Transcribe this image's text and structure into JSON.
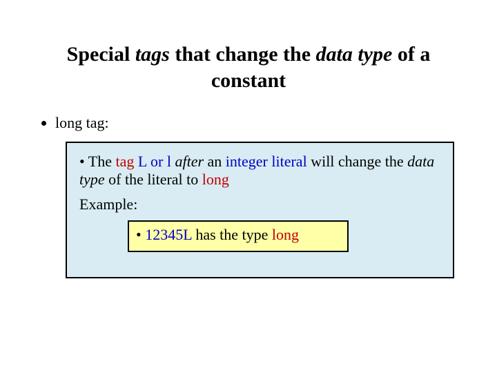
{
  "title": {
    "p1": "Special ",
    "p2": "tags",
    "p3": " that change the ",
    "p4": "data type",
    "p5": " of a constant"
  },
  "bullet1": "long tag:",
  "box": {
    "line1": {
      "t1": "• The ",
      "t2": "tag",
      "t3": " ",
      "t4": "L or l",
      "t5": " ",
      "t6": "after",
      "t7": " an ",
      "t8": "integer literal",
      "t9": " will change the ",
      "t10": "data type",
      "t11": " of the literal to ",
      "t12": "long"
    },
    "example_label": "Example:",
    "inner": {
      "t1": "• ",
      "t2": "12345L",
      "t3": " has the type ",
      "t4": "long"
    }
  }
}
